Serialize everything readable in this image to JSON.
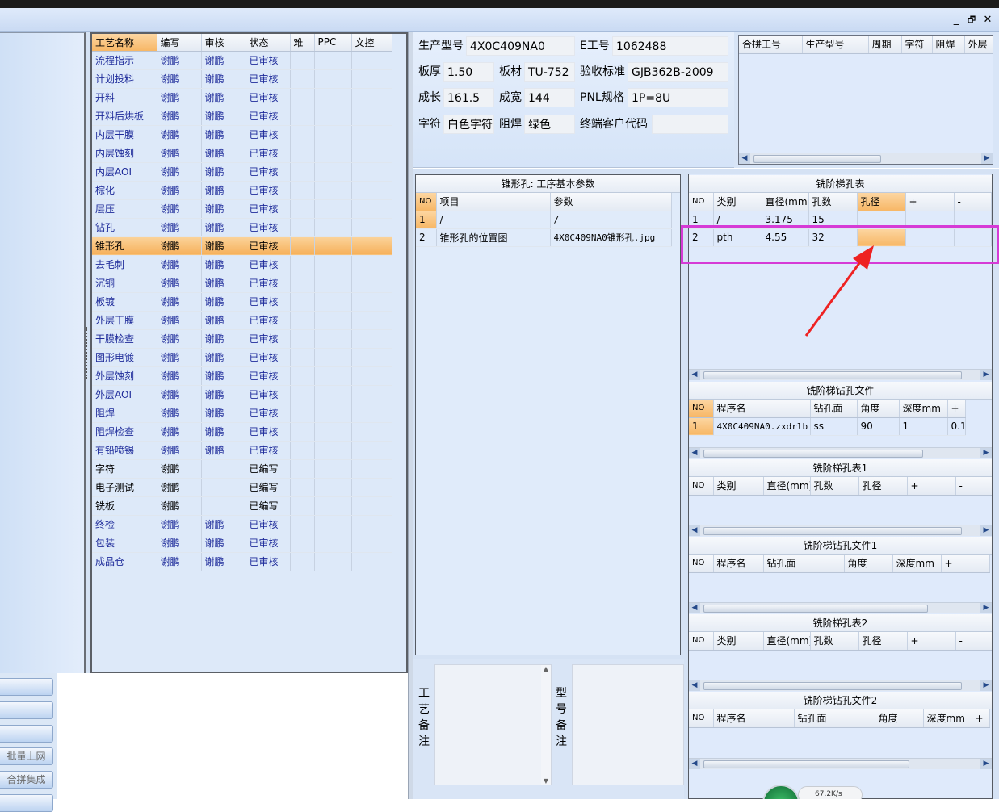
{
  "window": {
    "minimize_glyph": "_",
    "restore_glyph": "🗗",
    "close_glyph": "✕"
  },
  "left_side": {
    "buttons": [
      "",
      "",
      "",
      "批量上网",
      "合拼集成",
      ""
    ]
  },
  "process_list": {
    "headers": [
      "工艺名称",
      "编写",
      "审核",
      "状态",
      "难",
      "PPC",
      "文控"
    ],
    "rows": [
      [
        "流程指示",
        "谢鹏",
        "谢鹏",
        "已审核"
      ],
      [
        "计划投料",
        "谢鹏",
        "谢鹏",
        "已审核"
      ],
      [
        "开料",
        "谢鹏",
        "谢鹏",
        "已审核"
      ],
      [
        "开料后烘板",
        "谢鹏",
        "谢鹏",
        "已审核"
      ],
      [
        "内层干膜",
        "谢鹏",
        "谢鹏",
        "已审核"
      ],
      [
        "内层蚀刻",
        "谢鹏",
        "谢鹏",
        "已审核"
      ],
      [
        "内层AOI",
        "谢鹏",
        "谢鹏",
        "已审核"
      ],
      [
        "棕化",
        "谢鹏",
        "谢鹏",
        "已审核"
      ],
      [
        "层压",
        "谢鹏",
        "谢鹏",
        "已审核"
      ],
      [
        "钻孔",
        "谢鹏",
        "谢鹏",
        "已审核"
      ],
      [
        "锥形孔",
        "谢鹏",
        "谢鹏",
        "已审核"
      ],
      [
        "去毛刺",
        "谢鹏",
        "谢鹏",
        "已审核"
      ],
      [
        "沉铜",
        "谢鹏",
        "谢鹏",
        "已审核"
      ],
      [
        "板镀",
        "谢鹏",
        "谢鹏",
        "已审核"
      ],
      [
        "外层干膜",
        "谢鹏",
        "谢鹏",
        "已审核"
      ],
      [
        "干膜检查",
        "谢鹏",
        "谢鹏",
        "已审核"
      ],
      [
        "图形电镀",
        "谢鹏",
        "谢鹏",
        "已审核"
      ],
      [
        "外层蚀刻",
        "谢鹏",
        "谢鹏",
        "已审核"
      ],
      [
        "外层AOI",
        "谢鹏",
        "谢鹏",
        "已审核"
      ],
      [
        "阻焊",
        "谢鹏",
        "谢鹏",
        "已审核"
      ],
      [
        "阻焊检查",
        "谢鹏",
        "谢鹏",
        "已审核"
      ],
      [
        "有铅喷锡",
        "谢鹏",
        "谢鹏",
        "已审核"
      ],
      [
        "字符",
        "谢鹏",
        "",
        "已编写"
      ],
      [
        "电子测试",
        "谢鹏",
        "",
        "已编写"
      ],
      [
        "铣板",
        "谢鹏",
        "",
        "已编写"
      ],
      [
        "终检",
        "谢鹏",
        "谢鹏",
        "已审核"
      ],
      [
        "包装",
        "谢鹏",
        "谢鹏",
        "已审核"
      ],
      [
        "成品仓",
        "谢鹏",
        "谢鹏",
        "已审核"
      ]
    ],
    "selected_index": 10
  },
  "info": {
    "prod_model_label": "生产型号",
    "prod_model": "4X0C409NA0",
    "eno_label": "E工号",
    "eno": "1062488",
    "thickness_label": "板厚",
    "thickness": "1.50",
    "material_label": "板材",
    "material": "TU-752",
    "standard_label": "验收标准",
    "standard": "GJB362B-2009",
    "length_label": "成长",
    "length": "161.5",
    "width_label": "成宽",
    "width": "144",
    "pnl_label": "PNL规格",
    "pnl": "1P=8U",
    "char_label": "字符",
    "char": "白色字符",
    "mask_label": "阻焊",
    "mask": "绿色",
    "endcust_label": "终端客户代码",
    "endcust": ""
  },
  "merge_table": {
    "headers": [
      "合拼工号",
      "生产型号",
      "周期",
      "字符",
      "阻焊",
      "外层"
    ]
  },
  "params": {
    "title": "锥形孔: 工序基本参数",
    "headers": [
      "NO",
      "项目",
      "参数"
    ],
    "rows": [
      [
        "1",
        "/",
        "/"
      ],
      [
        "2",
        "锥形孔的位置图",
        "4X0C409NA0锥形孔.jpg"
      ]
    ]
  },
  "notes": {
    "process_label": "工艺备注",
    "model_label": "型号备注"
  },
  "step_hole": {
    "title": "铣阶梯孔表",
    "headers": [
      "NO",
      "类别",
      "直径(mm)",
      "孔数",
      "孔径",
      "+",
      "-"
    ],
    "rows": [
      [
        "1",
        "/",
        "3.175",
        "15",
        ""
      ],
      [
        "2",
        "pth",
        "4.55",
        "32",
        ""
      ]
    ]
  },
  "step_drill": {
    "title": "铣阶梯钻孔文件",
    "headers": [
      "NO",
      "程序名",
      "钻孔面",
      "角度",
      "深度mm",
      "+"
    ],
    "rows": [
      [
        "1",
        "4X0C409NA0.zxdrlb",
        "ss",
        "90",
        "1",
        "0.1"
      ]
    ]
  },
  "step_hole1": {
    "title": "铣阶梯孔表1",
    "headers": [
      "NO",
      "类别",
      "直径(mm)",
      "孔数",
      "孔径",
      "+",
      "-"
    ]
  },
  "step_drill1": {
    "title": "铣阶梯钻孔文件1",
    "headers": [
      "NO",
      "程序名",
      "钻孔面",
      "角度",
      "深度mm",
      "+"
    ]
  },
  "step_hole2": {
    "title": "铣阶梯孔表2",
    "headers": [
      "NO",
      "类别",
      "直径(mm)",
      "孔数",
      "孔径",
      "+",
      "-"
    ]
  },
  "step_drill2": {
    "title": "铣阶梯钻孔文件2",
    "headers": [
      "NO",
      "程序名",
      "钻孔面",
      "角度",
      "深度mm",
      "+"
    ]
  },
  "net_speed": {
    "value": "67.2K/s"
  },
  "colors": {
    "highlight_box": "#d63bd6",
    "arrow": "#ee2222",
    "selected_row": "#f7b766"
  }
}
